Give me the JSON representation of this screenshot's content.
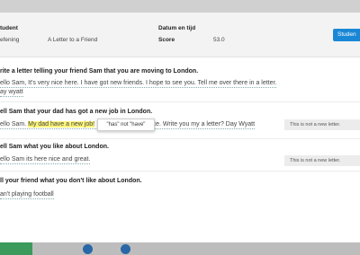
{
  "header": {
    "student_label": "tudent",
    "exercise_label": "efening",
    "exercise_value": "A Letter to a Friend",
    "date_label": "Datum en tijd",
    "score_label": "Score",
    "score_value": "53.0",
    "button_label": "Studen"
  },
  "items": [
    {
      "question": "rite a letter telling your friend Sam that you are moving to London.",
      "answer_line1": "ello Sam, It's very nice here. I have got new friends. I hope to see you. Tell me over there in a letter.",
      "answer_line2": "ay wyatt"
    },
    {
      "question": "ell Sam that your dad has got a new job in London.",
      "answer_before": "ello Sam. ",
      "answer_highlight": "My dad have a new job!",
      "answer_after": " very nice. Write you my a letter? Day Wyatt",
      "note": "This is not a new letter.",
      "tooltip": "\"has\" not \"have\""
    },
    {
      "question": "ell Sam what you like about London.",
      "answer_line1": "ello Sam its here nice and great.",
      "note": "This is not a new letter."
    },
    {
      "question": "ll your friend what you don't like about London.",
      "answer_line1": "an't playing football"
    }
  ]
}
